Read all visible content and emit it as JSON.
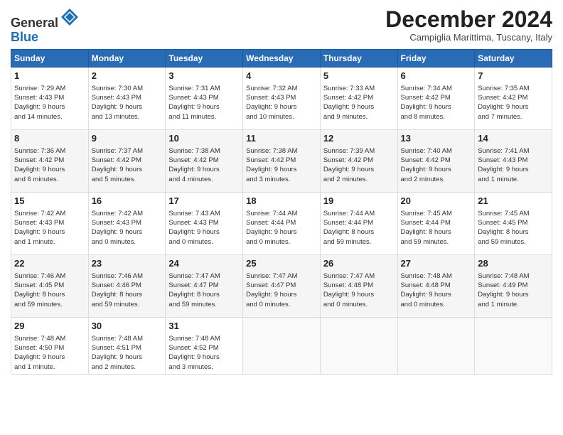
{
  "header": {
    "logo_line1": "General",
    "logo_line2": "Blue",
    "month_title": "December 2024",
    "location": "Campiglia Marittima, Tuscany, Italy"
  },
  "days_of_week": [
    "Sunday",
    "Monday",
    "Tuesday",
    "Wednesday",
    "Thursday",
    "Friday",
    "Saturday"
  ],
  "weeks": [
    [
      {
        "day": "1",
        "lines": [
          "Sunrise: 7:29 AM",
          "Sunset: 4:43 PM",
          "Daylight: 9 hours",
          "and 14 minutes."
        ]
      },
      {
        "day": "2",
        "lines": [
          "Sunrise: 7:30 AM",
          "Sunset: 4:43 PM",
          "Daylight: 9 hours",
          "and 13 minutes."
        ]
      },
      {
        "day": "3",
        "lines": [
          "Sunrise: 7:31 AM",
          "Sunset: 4:43 PM",
          "Daylight: 9 hours",
          "and 11 minutes."
        ]
      },
      {
        "day": "4",
        "lines": [
          "Sunrise: 7:32 AM",
          "Sunset: 4:43 PM",
          "Daylight: 9 hours",
          "and 10 minutes."
        ]
      },
      {
        "day": "5",
        "lines": [
          "Sunrise: 7:33 AM",
          "Sunset: 4:42 PM",
          "Daylight: 9 hours",
          "and 9 minutes."
        ]
      },
      {
        "day": "6",
        "lines": [
          "Sunrise: 7:34 AM",
          "Sunset: 4:42 PM",
          "Daylight: 9 hours",
          "and 8 minutes."
        ]
      },
      {
        "day": "7",
        "lines": [
          "Sunrise: 7:35 AM",
          "Sunset: 4:42 PM",
          "Daylight: 9 hours",
          "and 7 minutes."
        ]
      }
    ],
    [
      {
        "day": "8",
        "lines": [
          "Sunrise: 7:36 AM",
          "Sunset: 4:42 PM",
          "Daylight: 9 hours",
          "and 6 minutes."
        ]
      },
      {
        "day": "9",
        "lines": [
          "Sunrise: 7:37 AM",
          "Sunset: 4:42 PM",
          "Daylight: 9 hours",
          "and 5 minutes."
        ]
      },
      {
        "day": "10",
        "lines": [
          "Sunrise: 7:38 AM",
          "Sunset: 4:42 PM",
          "Daylight: 9 hours",
          "and 4 minutes."
        ]
      },
      {
        "day": "11",
        "lines": [
          "Sunrise: 7:38 AM",
          "Sunset: 4:42 PM",
          "Daylight: 9 hours",
          "and 3 minutes."
        ]
      },
      {
        "day": "12",
        "lines": [
          "Sunrise: 7:39 AM",
          "Sunset: 4:42 PM",
          "Daylight: 9 hours",
          "and 2 minutes."
        ]
      },
      {
        "day": "13",
        "lines": [
          "Sunrise: 7:40 AM",
          "Sunset: 4:42 PM",
          "Daylight: 9 hours",
          "and 2 minutes."
        ]
      },
      {
        "day": "14",
        "lines": [
          "Sunrise: 7:41 AM",
          "Sunset: 4:43 PM",
          "Daylight: 9 hours",
          "and 1 minute."
        ]
      }
    ],
    [
      {
        "day": "15",
        "lines": [
          "Sunrise: 7:42 AM",
          "Sunset: 4:43 PM",
          "Daylight: 9 hours",
          "and 1 minute."
        ]
      },
      {
        "day": "16",
        "lines": [
          "Sunrise: 7:42 AM",
          "Sunset: 4:43 PM",
          "Daylight: 9 hours",
          "and 0 minutes."
        ]
      },
      {
        "day": "17",
        "lines": [
          "Sunrise: 7:43 AM",
          "Sunset: 4:43 PM",
          "Daylight: 9 hours",
          "and 0 minutes."
        ]
      },
      {
        "day": "18",
        "lines": [
          "Sunrise: 7:44 AM",
          "Sunset: 4:44 PM",
          "Daylight: 9 hours",
          "and 0 minutes."
        ]
      },
      {
        "day": "19",
        "lines": [
          "Sunrise: 7:44 AM",
          "Sunset: 4:44 PM",
          "Daylight: 8 hours",
          "and 59 minutes."
        ]
      },
      {
        "day": "20",
        "lines": [
          "Sunrise: 7:45 AM",
          "Sunset: 4:44 PM",
          "Daylight: 8 hours",
          "and 59 minutes."
        ]
      },
      {
        "day": "21",
        "lines": [
          "Sunrise: 7:45 AM",
          "Sunset: 4:45 PM",
          "Daylight: 8 hours",
          "and 59 minutes."
        ]
      }
    ],
    [
      {
        "day": "22",
        "lines": [
          "Sunrise: 7:46 AM",
          "Sunset: 4:45 PM",
          "Daylight: 8 hours",
          "and 59 minutes."
        ]
      },
      {
        "day": "23",
        "lines": [
          "Sunrise: 7:46 AM",
          "Sunset: 4:46 PM",
          "Daylight: 8 hours",
          "and 59 minutes."
        ]
      },
      {
        "day": "24",
        "lines": [
          "Sunrise: 7:47 AM",
          "Sunset: 4:47 PM",
          "Daylight: 8 hours",
          "and 59 minutes."
        ]
      },
      {
        "day": "25",
        "lines": [
          "Sunrise: 7:47 AM",
          "Sunset: 4:47 PM",
          "Daylight: 9 hours",
          "and 0 minutes."
        ]
      },
      {
        "day": "26",
        "lines": [
          "Sunrise: 7:47 AM",
          "Sunset: 4:48 PM",
          "Daylight: 9 hours",
          "and 0 minutes."
        ]
      },
      {
        "day": "27",
        "lines": [
          "Sunrise: 7:48 AM",
          "Sunset: 4:48 PM",
          "Daylight: 9 hours",
          "and 0 minutes."
        ]
      },
      {
        "day": "28",
        "lines": [
          "Sunrise: 7:48 AM",
          "Sunset: 4:49 PM",
          "Daylight: 9 hours",
          "and 1 minute."
        ]
      }
    ],
    [
      {
        "day": "29",
        "lines": [
          "Sunrise: 7:48 AM",
          "Sunset: 4:50 PM",
          "Daylight: 9 hours",
          "and 1 minute."
        ]
      },
      {
        "day": "30",
        "lines": [
          "Sunrise: 7:48 AM",
          "Sunset: 4:51 PM",
          "Daylight: 9 hours",
          "and 2 minutes."
        ]
      },
      {
        "day": "31",
        "lines": [
          "Sunrise: 7:48 AM",
          "Sunset: 4:52 PM",
          "Daylight: 9 hours",
          "and 3 minutes."
        ]
      },
      {
        "day": "",
        "lines": []
      },
      {
        "day": "",
        "lines": []
      },
      {
        "day": "",
        "lines": []
      },
      {
        "day": "",
        "lines": []
      }
    ]
  ]
}
